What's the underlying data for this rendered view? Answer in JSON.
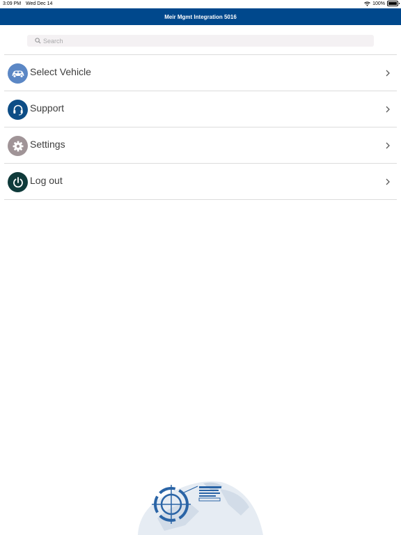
{
  "status_bar": {
    "time": "3:09 PM",
    "date": "Wed Dec 14",
    "battery": "100%"
  },
  "nav": {
    "title": "Meir Mgmt Integration 5016"
  },
  "search": {
    "placeholder": "Search",
    "value": ""
  },
  "menu": {
    "items": [
      {
        "label": "Select Vehicle",
        "icon": "car-icon",
        "color": "#5b87c5"
      },
      {
        "label": "Support",
        "icon": "headset-icon",
        "color": "#0d4d86"
      },
      {
        "label": "Settings",
        "icon": "gear-icon",
        "color": "#a09497"
      },
      {
        "label": "Log out",
        "icon": "power-icon",
        "color": "#0f3a3a"
      }
    ]
  },
  "colors": {
    "nav_background": "#00488c",
    "divider": "#dcdcdc",
    "chevron": "#5a5a5a"
  }
}
